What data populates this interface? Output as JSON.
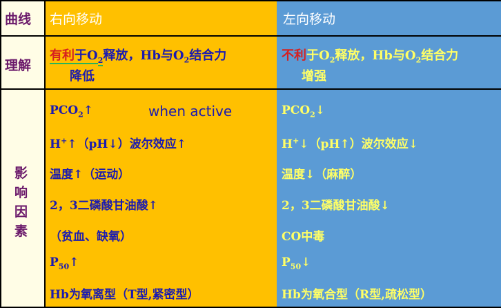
{
  "header": {
    "col0": "曲线",
    "col1": "右向移动",
    "col2": "左向移动"
  },
  "understanding": {
    "label": "理解",
    "right_prefix": "有利",
    "right_text_a": "于O",
    "right_sub": "2",
    "right_text_b": "释放，Hb与O",
    "right_sub2": "2",
    "right_text_c": "结合力",
    "right_line2": "降低",
    "left_prefix": "不利",
    "left_text_a": "于O",
    "left_sub": "2",
    "left_text_b": "释放，Hb与O",
    "left_sub2": "2",
    "left_text_c": "结合力",
    "left_line2": "增强"
  },
  "factors": {
    "label_chars": [
      "影",
      "响",
      "因",
      "素"
    ],
    "right": {
      "pco2_a": "PCO",
      "pco2_sub": "2",
      "pco2_arrow": "↑",
      "when_active": "when active",
      "h_a": "H",
      "h_sup": "+",
      "h_b": "↑（pH↓）波尔效应↑",
      "temp": "温度↑（运动）",
      "dpg": "2，3二磷酸甘油酸↑",
      "anemia": "（贫血、缺氧）",
      "p50_a": "P",
      "p50_sub": "50",
      "p50_arrow": "↑",
      "hb": "Hb为氧离型（T型,紧密型）"
    },
    "left": {
      "pco2_a": "PCO",
      "pco2_sub": "2",
      "pco2_arrow": "↓",
      "h_a": "H",
      "h_sup": "+",
      "h_b": "↓（pH↑）波尔效应↓",
      "temp": "温度↓（麻醉）",
      "dpg": "2，3二磷酸甘油酸↓",
      "co": "CO中毒",
      "p50_a": "P",
      "p50_sub": "50",
      "p50_arrow": "↓",
      "hb": "Hb为氧合型（R型,疏松型）"
    }
  },
  "colors": {
    "yellow_cell": "#ffc000",
    "blue_cell": "#5b9bd5",
    "label_cell": "#fffde6",
    "label_text": "#6b1a6b",
    "right_text": "#1b1bb0",
    "left_text": "#ffff66",
    "red_emphasis": "#d62020"
  }
}
